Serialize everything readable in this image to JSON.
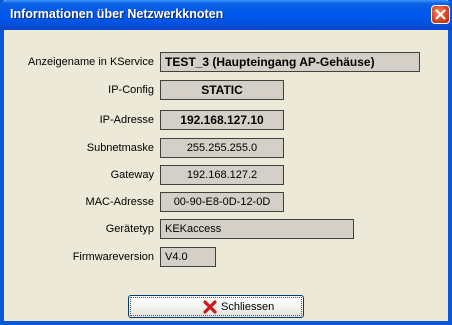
{
  "window": {
    "title": "Informationen über Netzwerkknoten"
  },
  "fields": {
    "anzeigename": {
      "label": "Anzeigename in KService",
      "value": "TEST_3 (Haupteingang AP-Gehäuse)"
    },
    "ip_config": {
      "label": "IP-Config",
      "value": "STATIC"
    },
    "ip_adresse": {
      "label": "IP-Adresse",
      "value": "192.168.127.10"
    },
    "subnetmaske": {
      "label": "Subnetmaske",
      "value": "255.255.255.0"
    },
    "gateway": {
      "label": "Gateway",
      "value": "192.168.127.2"
    },
    "mac_adresse": {
      "label": "MAC-Adresse",
      "value": "00-90-E8-0D-12-0D"
    },
    "geraetetyp": {
      "label": "Gerätetyp",
      "value": "KEKaccess"
    },
    "firmwareversion": {
      "label": "Firmwareversion",
      "value": "V4.0"
    }
  },
  "buttons": {
    "close_label": "Schliessen"
  },
  "colors": {
    "titlebar": "#0058ee",
    "background": "#ece9d8",
    "field": "#d4d0c8",
    "close_button": "#d9421c"
  }
}
